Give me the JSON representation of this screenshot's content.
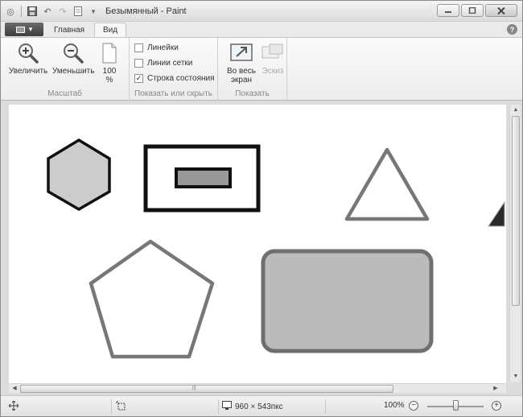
{
  "window": {
    "title": "Безымянный - Paint"
  },
  "tabs": {
    "home": "Главная",
    "view": "Вид"
  },
  "ribbon": {
    "zoom_group": {
      "label": "Масштаб",
      "zoom_in": "Увеличить",
      "zoom_out": "Уменьшить",
      "zoom_100": "100 %"
    },
    "show_hide_group": {
      "label": "Показать или скрыть",
      "rulers": "Линейки",
      "gridlines": "Линии сетки",
      "status_bar": "Строка состояния",
      "rulers_checked": false,
      "gridlines_checked": false,
      "status_bar_checked": true
    },
    "display_group": {
      "label": "Показать",
      "fullscreen": "Во весь экран",
      "thumbnail": "Эскиз"
    }
  },
  "canvas": {
    "shapes": [
      "hexagon",
      "rectangle-with-inner-rectangle",
      "triangle",
      "pentagon",
      "rounded-rectangle"
    ]
  },
  "statusbar": {
    "dimensions": "960 × 543пкс",
    "zoom": "100%"
  }
}
